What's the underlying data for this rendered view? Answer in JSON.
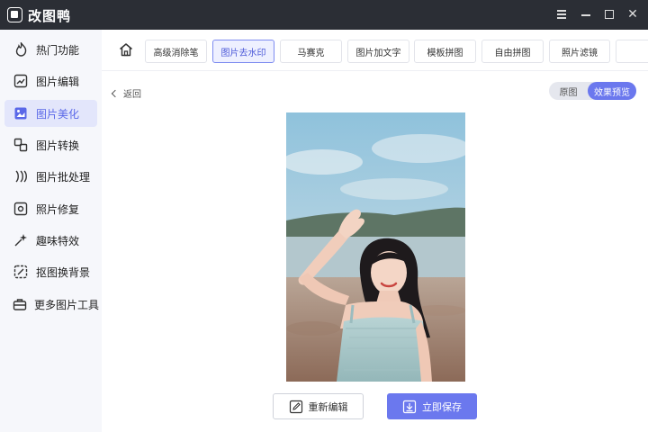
{
  "app": {
    "name": "改图鸭"
  },
  "window_controls": {
    "menu": "menu-icon",
    "minimize": "minimize-icon",
    "maximize": "maximize-icon",
    "close": "close-icon"
  },
  "sidebar": {
    "active_index": 2,
    "items": [
      {
        "label": "热门功能",
        "icon": "flame-icon"
      },
      {
        "label": "图片编辑",
        "icon": "image-edit-icon"
      },
      {
        "label": "图片美化",
        "icon": "image-beautify-icon"
      },
      {
        "label": "图片转换",
        "icon": "convert-icon"
      },
      {
        "label": "图片批处理",
        "icon": "batch-icon"
      },
      {
        "label": "照片修复",
        "icon": "repair-icon"
      },
      {
        "label": "趣味特效",
        "icon": "sparkle-icon"
      },
      {
        "label": "抠图换背景",
        "icon": "cutout-icon"
      },
      {
        "label": "更多图片工具",
        "icon": "toolbox-icon"
      }
    ]
  },
  "toolbar": {
    "home_icon": "home-icon",
    "active_index": 1,
    "tabs": [
      "高级消除笔",
      "图片去水印",
      "马赛克",
      "图片加文字",
      "模板拼图",
      "自由拼图",
      "照片滤镜",
      ""
    ]
  },
  "content": {
    "back_label": "返回",
    "view_toggle": {
      "original": "原图",
      "preview": "效果预览",
      "selected": "preview"
    },
    "buttons": {
      "edit": "重新编辑",
      "save": "立即保存"
    }
  },
  "colors": {
    "accent": "#6b78ee",
    "titlebar": "#2b2e35",
    "sidebar_bg": "#f6f7fb",
    "active_bg": "#e3e6fb"
  }
}
